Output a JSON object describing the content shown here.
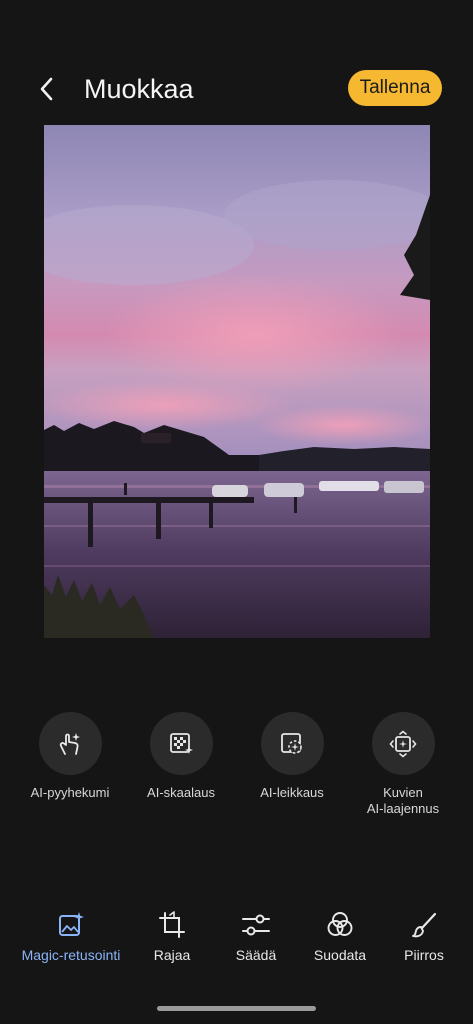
{
  "header": {
    "title": "Muokkaa",
    "save_label": "Tallenna",
    "back_icon": "chevron-left-icon",
    "accent_color": "#f5b830"
  },
  "ai_tools": [
    {
      "label": "AI-pyyhekumi",
      "icon": "ai-eraser-icon"
    },
    {
      "label": "AI-skaalaus",
      "icon": "ai-upscale-icon"
    },
    {
      "label": "AI-leikkaus",
      "icon": "ai-cutout-icon"
    },
    {
      "label": "Kuvien\nAI-laajennus",
      "icon": "ai-expand-icon"
    }
  ],
  "bottom_nav": [
    {
      "label": "Magic-retusointi",
      "icon": "magic-image-icon",
      "active": true
    },
    {
      "label": "Rajaa",
      "icon": "crop-icon"
    },
    {
      "label": "Säädä",
      "icon": "sliders-icon"
    },
    {
      "label": "Suodata",
      "icon": "filter-icon"
    },
    {
      "label": "Piirros",
      "icon": "brush-icon"
    }
  ],
  "colors": {
    "background": "#151515",
    "active_nav": "#8ab4f8",
    "tool_circle": "#2b2b2b"
  }
}
